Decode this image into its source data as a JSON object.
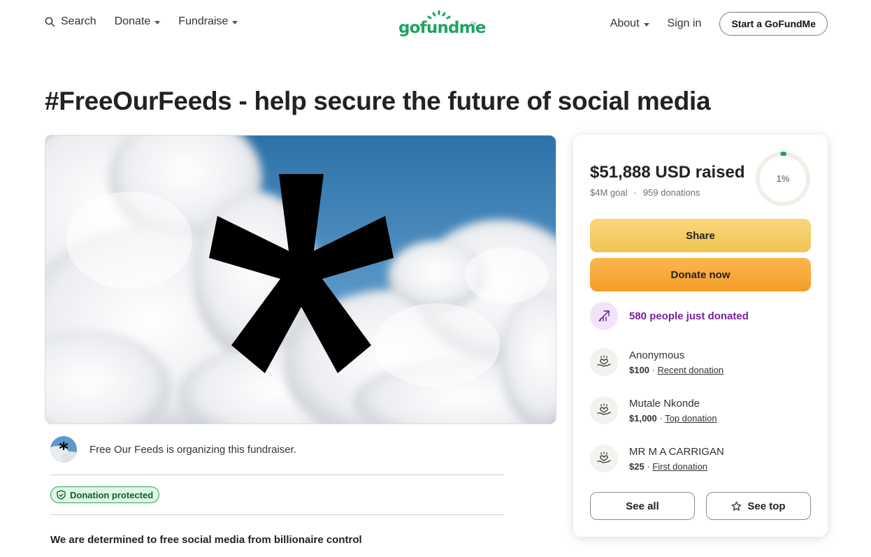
{
  "nav": {
    "search_label": "Search",
    "donate_label": "Donate",
    "fundraise_label": "Fundraise",
    "logo_text": "gofundme",
    "about_label": "About",
    "signin_label": "Sign in",
    "start_label": "Start a GoFundMe"
  },
  "page_title": "#FreeOurFeeds - help secure the future of social media",
  "organizer_text": "Free Our Feeds is organizing this fundraiser.",
  "badge_label": "Donation protected",
  "story_heading": "We are determined to free social media from billionaire control",
  "card": {
    "raised": "$51,888 USD raised",
    "goal": "$4M goal",
    "donations": "959 donations",
    "percent": "1%",
    "progress_fraction": 0.013,
    "share_label": "Share",
    "donate_label": "Donate now",
    "recent_label": "580 people just donated",
    "donors": [
      {
        "name": "Anonymous",
        "amount": "$100",
        "tag": "Recent donation"
      },
      {
        "name": "Mutale Nkonde",
        "amount": "$1,000",
        "tag": "Top donation"
      },
      {
        "name": "MR M A CARRIGAN",
        "amount": "$25",
        "tag": "First donation"
      }
    ],
    "see_all_label": "See all",
    "see_top_label": "See top"
  },
  "colors": {
    "brand_green": "#1fa363",
    "share_yellow": "#f1c453",
    "donate_orange": "#f59d2a",
    "accent_purple": "#7a1fa2"
  },
  "icons": [
    "search-icon",
    "chevron-down-icon",
    "shield-check-icon",
    "trend-up-icon",
    "heart-hand-icon",
    "star-icon"
  ]
}
